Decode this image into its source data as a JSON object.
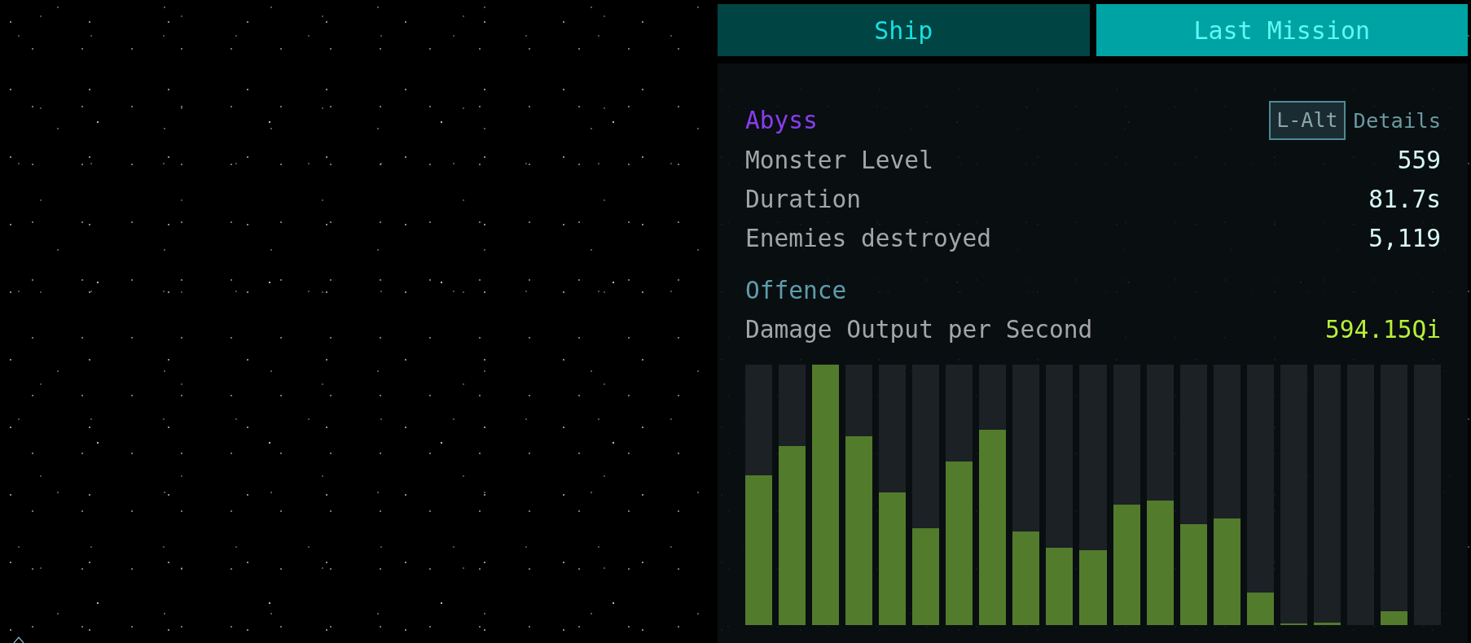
{
  "tabs": [
    {
      "label": "Ship",
      "selected": false
    },
    {
      "label": "Last Mission",
      "selected": true
    }
  ],
  "mission": {
    "title": "Abyss",
    "details_key": "L-Alt",
    "details_label": "Details",
    "stats": [
      {
        "label": "Monster Level",
        "value": "559"
      },
      {
        "label": "Duration",
        "value": "81.7s"
      },
      {
        "label": "Enemies destroyed",
        "value": "5,119"
      }
    ]
  },
  "offence": {
    "title": "Offence",
    "stats": [
      {
        "label": "Damage Output per Second",
        "value": "594.15Qi"
      }
    ]
  }
}
